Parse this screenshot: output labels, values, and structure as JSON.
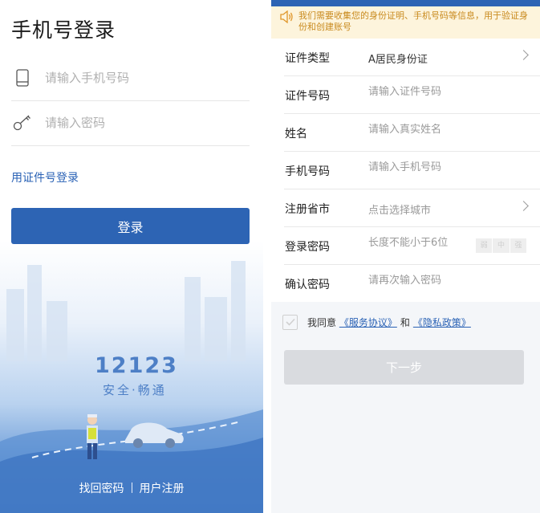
{
  "left": {
    "title": "手机号登录",
    "phone_placeholder": "请输入手机号码",
    "password_placeholder": "请输入密码",
    "id_login_link": "用证件号登录",
    "login_button": "登录",
    "logo_number": "12123",
    "logo_slogan": "安全·畅通",
    "find_password": "找回密码",
    "register": "用户注册"
  },
  "right": {
    "notice": "我们需要收集您的身份证明、手机号码等信息，用于验证身份和创建账号",
    "rows": [
      {
        "label": "证件类型",
        "value": "A居民身份证"
      },
      {
        "label": "证件号码",
        "placeholder": "请输入证件号码"
      },
      {
        "label": "姓名",
        "placeholder": "请输入真实姓名"
      },
      {
        "label": "手机号码",
        "placeholder": "请输入手机号码"
      },
      {
        "label": "注册省市",
        "placeholder": "点击选择城市"
      },
      {
        "label": "登录密码",
        "placeholder": "长度不能小于6位"
      },
      {
        "label": "确认密码",
        "placeholder": "请再次输入密码"
      }
    ],
    "strength": [
      "弱",
      "中",
      "强"
    ],
    "agree_prefix": "我同意",
    "service_agreement": "《服务协议》",
    "agree_and": "和",
    "privacy_policy": "《隐私政策》",
    "next_button": "下一步"
  },
  "colors": {
    "primary": "#2d64b4",
    "link": "#2a62b5",
    "notice_bg": "#fdf4dc",
    "notice_text": "#c98a1e",
    "disabled_button": "#d9dbdf"
  }
}
